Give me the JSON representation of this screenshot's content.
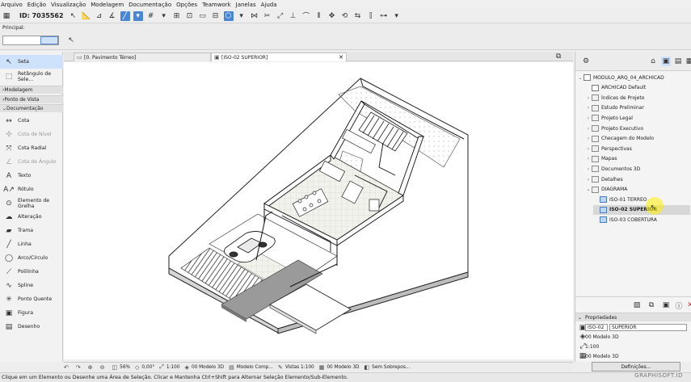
{
  "menu": [
    "Arquivo",
    "Edição",
    "Visualização",
    "Modelagem",
    "Documentação",
    "Opções",
    "Teamwork",
    "Janelas",
    "Ajuda"
  ],
  "toolbar": {
    "id_label": "ID: 7035562"
  },
  "infobox": {
    "label": "Principal:"
  },
  "toolbox": {
    "items": [
      {
        "label": "Seta",
        "icon": "arrow-icon",
        "glyph": "↖",
        "state": "selected"
      },
      {
        "label": "Retângulo de Sele...",
        "icon": "marquee-icon",
        "glyph": "⬚",
        "state": "normal"
      }
    ],
    "sections": [
      "Modelagem",
      "Ponto de Vista",
      "Documentação"
    ],
    "doc_items": [
      {
        "label": "Cota",
        "icon": "dimension-icon",
        "glyph": "↔",
        "state": "normal"
      },
      {
        "label": "Cota de Nível",
        "icon": "level-dimension-icon",
        "glyph": "✣",
        "state": "disabled"
      },
      {
        "label": "Cota Radial",
        "icon": "radial-dimension-icon",
        "glyph": "⤧",
        "state": "normal"
      },
      {
        "label": "Cota de Ângulo",
        "icon": "angle-dimension-icon",
        "glyph": "∠",
        "state": "disabled"
      },
      {
        "label": "Texto",
        "icon": "text-icon",
        "glyph": "A",
        "state": "normal"
      },
      {
        "label": "Rótulo",
        "icon": "label-icon",
        "glyph": "A↗",
        "state": "normal"
      },
      {
        "label": "Elemento de Grelha",
        "icon": "grid-element-icon",
        "glyph": "⊙",
        "state": "normal"
      },
      {
        "label": "Alteração",
        "icon": "change-icon",
        "glyph": "☁",
        "state": "normal"
      },
      {
        "label": "Trama",
        "icon": "fill-icon",
        "glyph": "▰",
        "state": "normal"
      },
      {
        "label": "Linha",
        "icon": "line-icon",
        "glyph": "╱",
        "state": "normal"
      },
      {
        "label": "Arco/Círculo",
        "icon": "arc-icon",
        "glyph": "◯",
        "state": "normal"
      },
      {
        "label": "Polilinha",
        "icon": "polyline-icon",
        "glyph": "⟋",
        "state": "normal"
      },
      {
        "label": "Spline",
        "icon": "spline-icon",
        "glyph": "∿",
        "state": "normal"
      },
      {
        "label": "Ponto Quente",
        "icon": "hotspot-icon",
        "glyph": "✳",
        "state": "normal"
      },
      {
        "label": "Figura",
        "icon": "figure-icon",
        "glyph": "▣",
        "state": "normal"
      },
      {
        "label": "Desenho",
        "icon": "drawing-icon",
        "glyph": "▤",
        "state": "normal"
      }
    ]
  },
  "tabs": [
    {
      "label": "[0. Pavimento Térreo]",
      "active": false
    },
    {
      "label": "[ISO-02 SUPERIOR]",
      "active": true
    }
  ],
  "navigator": {
    "items": [
      {
        "label": "MODULO_ARQ_04_ARCHICAD",
        "level": 0,
        "arrow": "⌄",
        "icon": "doc"
      },
      {
        "label": "ARCHICAD Default",
        "level": 1,
        "arrow": "",
        "icon": "doc"
      },
      {
        "label": "Índices de Projeto",
        "level": 1,
        "arrow": "›",
        "icon": "folder"
      },
      {
        "label": "Estudo Preliminar",
        "level": 1,
        "arrow": "›",
        "icon": "folder"
      },
      {
        "label": "Projeto Legal",
        "level": 1,
        "arrow": "›",
        "icon": "folder"
      },
      {
        "label": "Projeto Executivo",
        "level": 1,
        "arrow": "›",
        "icon": "folder"
      },
      {
        "label": "Checagem do Modelo",
        "level": 1,
        "arrow": "›",
        "icon": "folder"
      },
      {
        "label": "Perspectivas",
        "level": 1,
        "arrow": "›",
        "icon": "folder"
      },
      {
        "label": "Mapas",
        "level": 1,
        "arrow": "›",
        "icon": "folder"
      },
      {
        "label": "Documentos 3D",
        "level": 1,
        "arrow": "›",
        "icon": "folder"
      },
      {
        "label": "Detalhes",
        "level": 1,
        "arrow": "›",
        "icon": "folder"
      },
      {
        "label": "DIAGRAMA",
        "level": 1,
        "arrow": "⌄",
        "icon": "folder"
      },
      {
        "label": "ISO-01 TERREO",
        "level": 2,
        "arrow": "",
        "icon": "view"
      },
      {
        "label": "ISO-02 SUPERIOR",
        "level": 2,
        "arrow": "",
        "icon": "view",
        "selected": true
      },
      {
        "label": "ISO-03 COBERTURA",
        "level": 2,
        "arrow": "",
        "icon": "view"
      }
    ]
  },
  "properties": {
    "header": "Propriedades",
    "id": "ISO-02",
    "name": "SUPERIOR",
    "row1": "00 Modelo 3D",
    "row2": "1:100",
    "row3": "00 Modelo 3D",
    "button": "Definições..."
  },
  "statusbar": {
    "zoom": "56%",
    "angle": "0,00°",
    "scale": "1:100",
    "layer": "00 Modelo 3D",
    "model": "Modelo Comp...",
    "vistas": "Vistas 1:100",
    "layer2": "00 Modelo 3D",
    "override": "Sem Sobrepos..."
  },
  "status_message": "Clique em um Elemento ou Desenhe uma Área de Seleção. Clicar e Mantenha Ctrl+Shift para Alternar Seleção Elemento/Sub-Elemento.",
  "brand": "GRAPHISOFT.ID"
}
